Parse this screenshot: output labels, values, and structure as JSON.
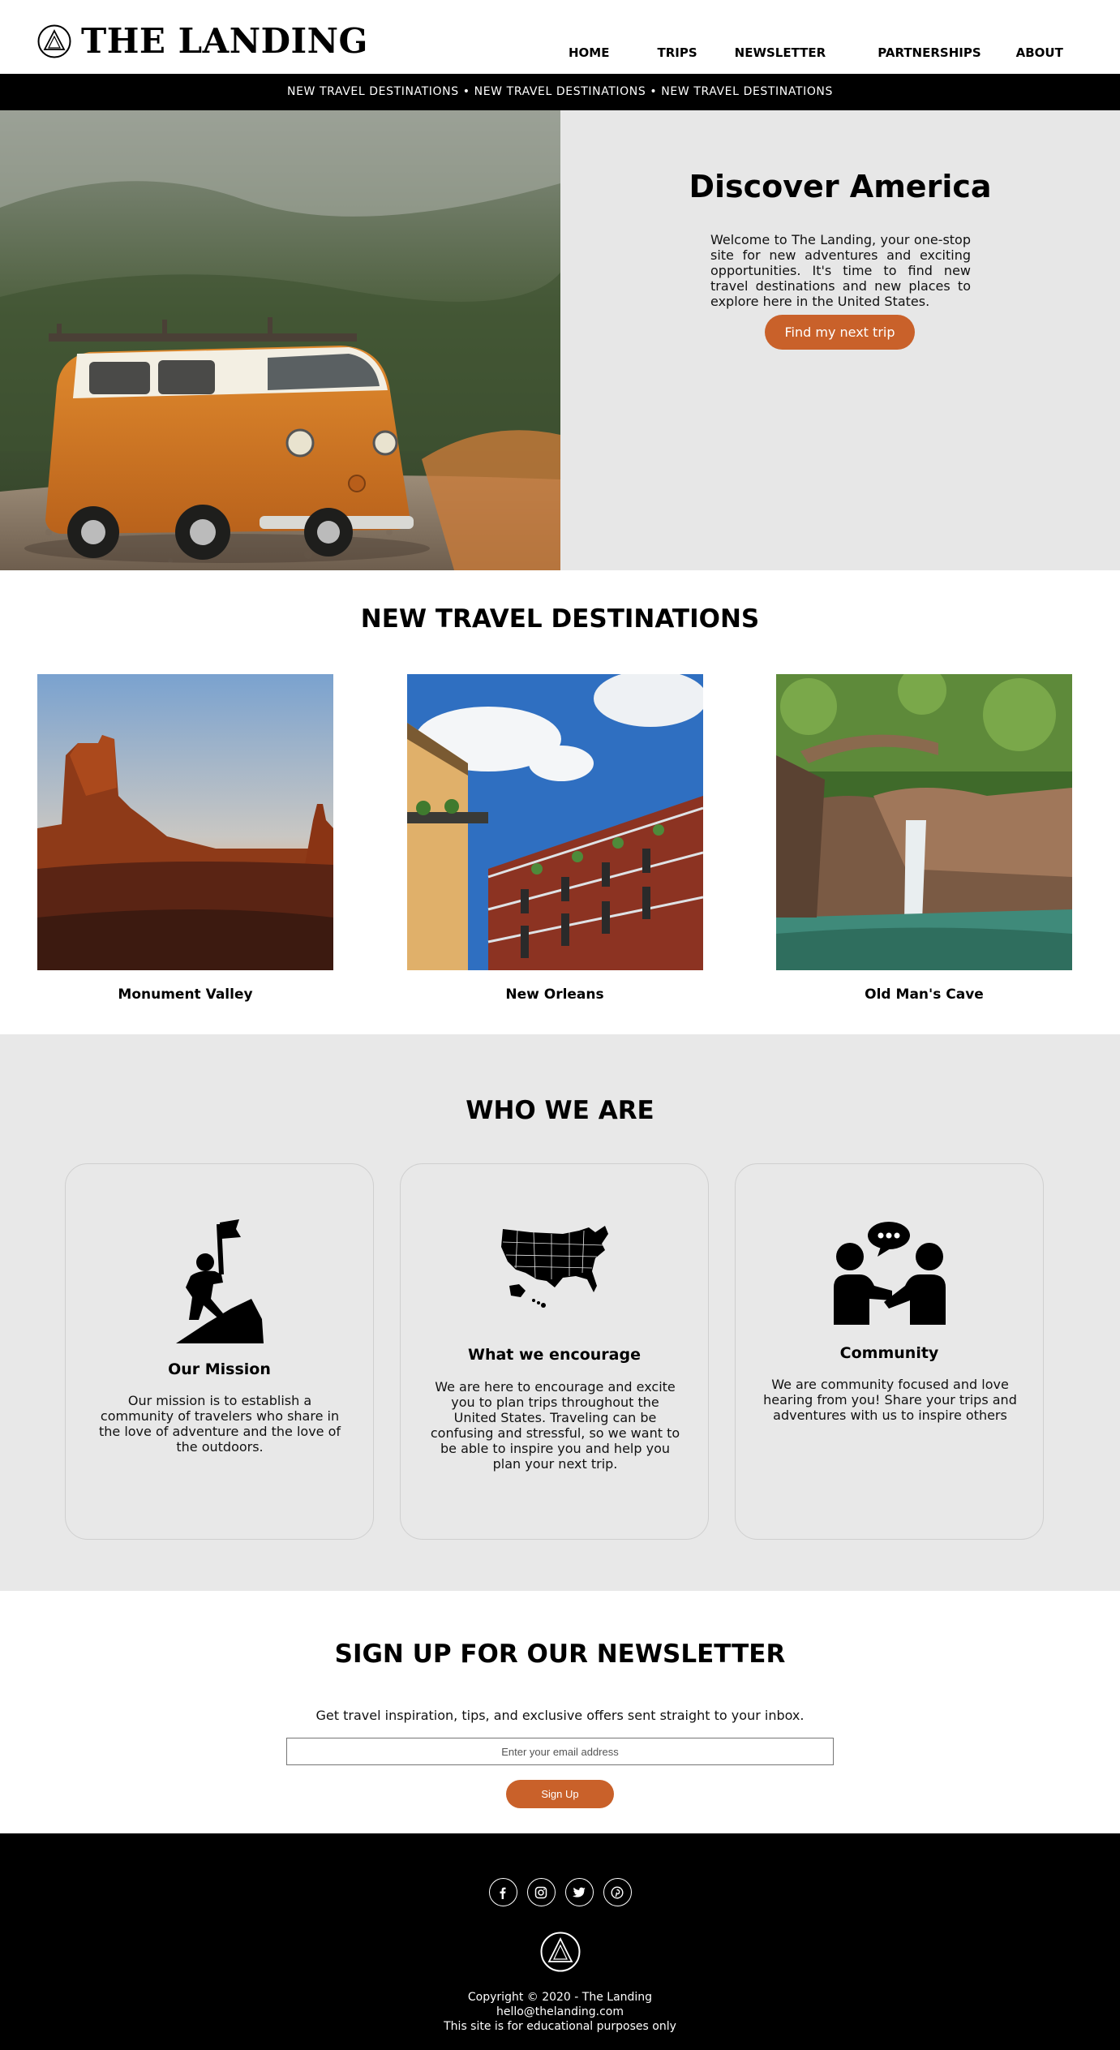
{
  "brand": {
    "name": "THE LANDING",
    "logo_icon": "triangle-in-circle-icon"
  },
  "nav": {
    "items": [
      {
        "label": "HOME"
      },
      {
        "label": "TRIPS"
      },
      {
        "label": "NEWSLETTER"
      },
      {
        "label": "PARTNERSHIPS"
      },
      {
        "label": "ABOUT"
      }
    ]
  },
  "ticker": {
    "text": "NEW TRAVEL DESTINATIONS • NEW TRAVEL DESTINATIONS • NEW TRAVEL DESTINATIONS"
  },
  "hero": {
    "image_icon": "orange-vw-van-photo",
    "title": "Discover America",
    "text": "Welcome to The Landing, your one-stop site for new adventures and exciting opportunities. It's time to find new travel destinations and new places to explore here in the United States.",
    "button_label": "Find my next trip"
  },
  "destinations": {
    "title": "NEW TRAVEL DESTINATIONS",
    "items": [
      {
        "name": "Monument Valley",
        "image_icon": "monument-valley-photo"
      },
      {
        "name": "New Orleans",
        "image_icon": "new-orleans-photo"
      },
      {
        "name": "Old Man's Cave",
        "image_icon": "old-mans-cave-photo"
      }
    ]
  },
  "who": {
    "title": "WHO WE ARE",
    "cards": [
      {
        "title": "Our Mission",
        "text": "Our mission is to establish a community of travelers who share in the love of adventure and the love of the outdoors.",
        "icon": "hiker-flag-icon"
      },
      {
        "title": "What we encourage",
        "text": "We are here to encourage and excite you to plan trips throughout the United States. Traveling can be confusing and stressful, so we want to be able to inspire you and help you plan your next trip.",
        "icon": "usa-map-icon"
      },
      {
        "title": "Community",
        "text": "We are community focused and love hearing from you! Share your trips and adventures with us to inspire others",
        "icon": "people-chat-icon"
      }
    ]
  },
  "newsletter": {
    "title": "SIGN UP FOR OUR NEWSLETTER",
    "subtitle": "Get travel inspiration, tips, and exclusive offers sent straight to your inbox.",
    "input_placeholder": "Enter your email address",
    "button_label": "Sign Up"
  },
  "footer": {
    "socials": [
      {
        "icon": "facebook-icon",
        "glyph": "f"
      },
      {
        "icon": "instagram-icon",
        "glyph": ""
      },
      {
        "icon": "twitter-icon",
        "glyph": ""
      },
      {
        "icon": "pinterest-icon",
        "glyph": "p"
      }
    ],
    "copyright": "Copyright © 2020 - The Landing",
    "email": "hello@thelanding.com",
    "disclaimer": "This site is for educational purposes only"
  },
  "colors": {
    "accent": "#c9612a",
    "hero_bg": "#e7e7e7",
    "section_bg": "#e8e8e8",
    "dark": "#000000"
  }
}
